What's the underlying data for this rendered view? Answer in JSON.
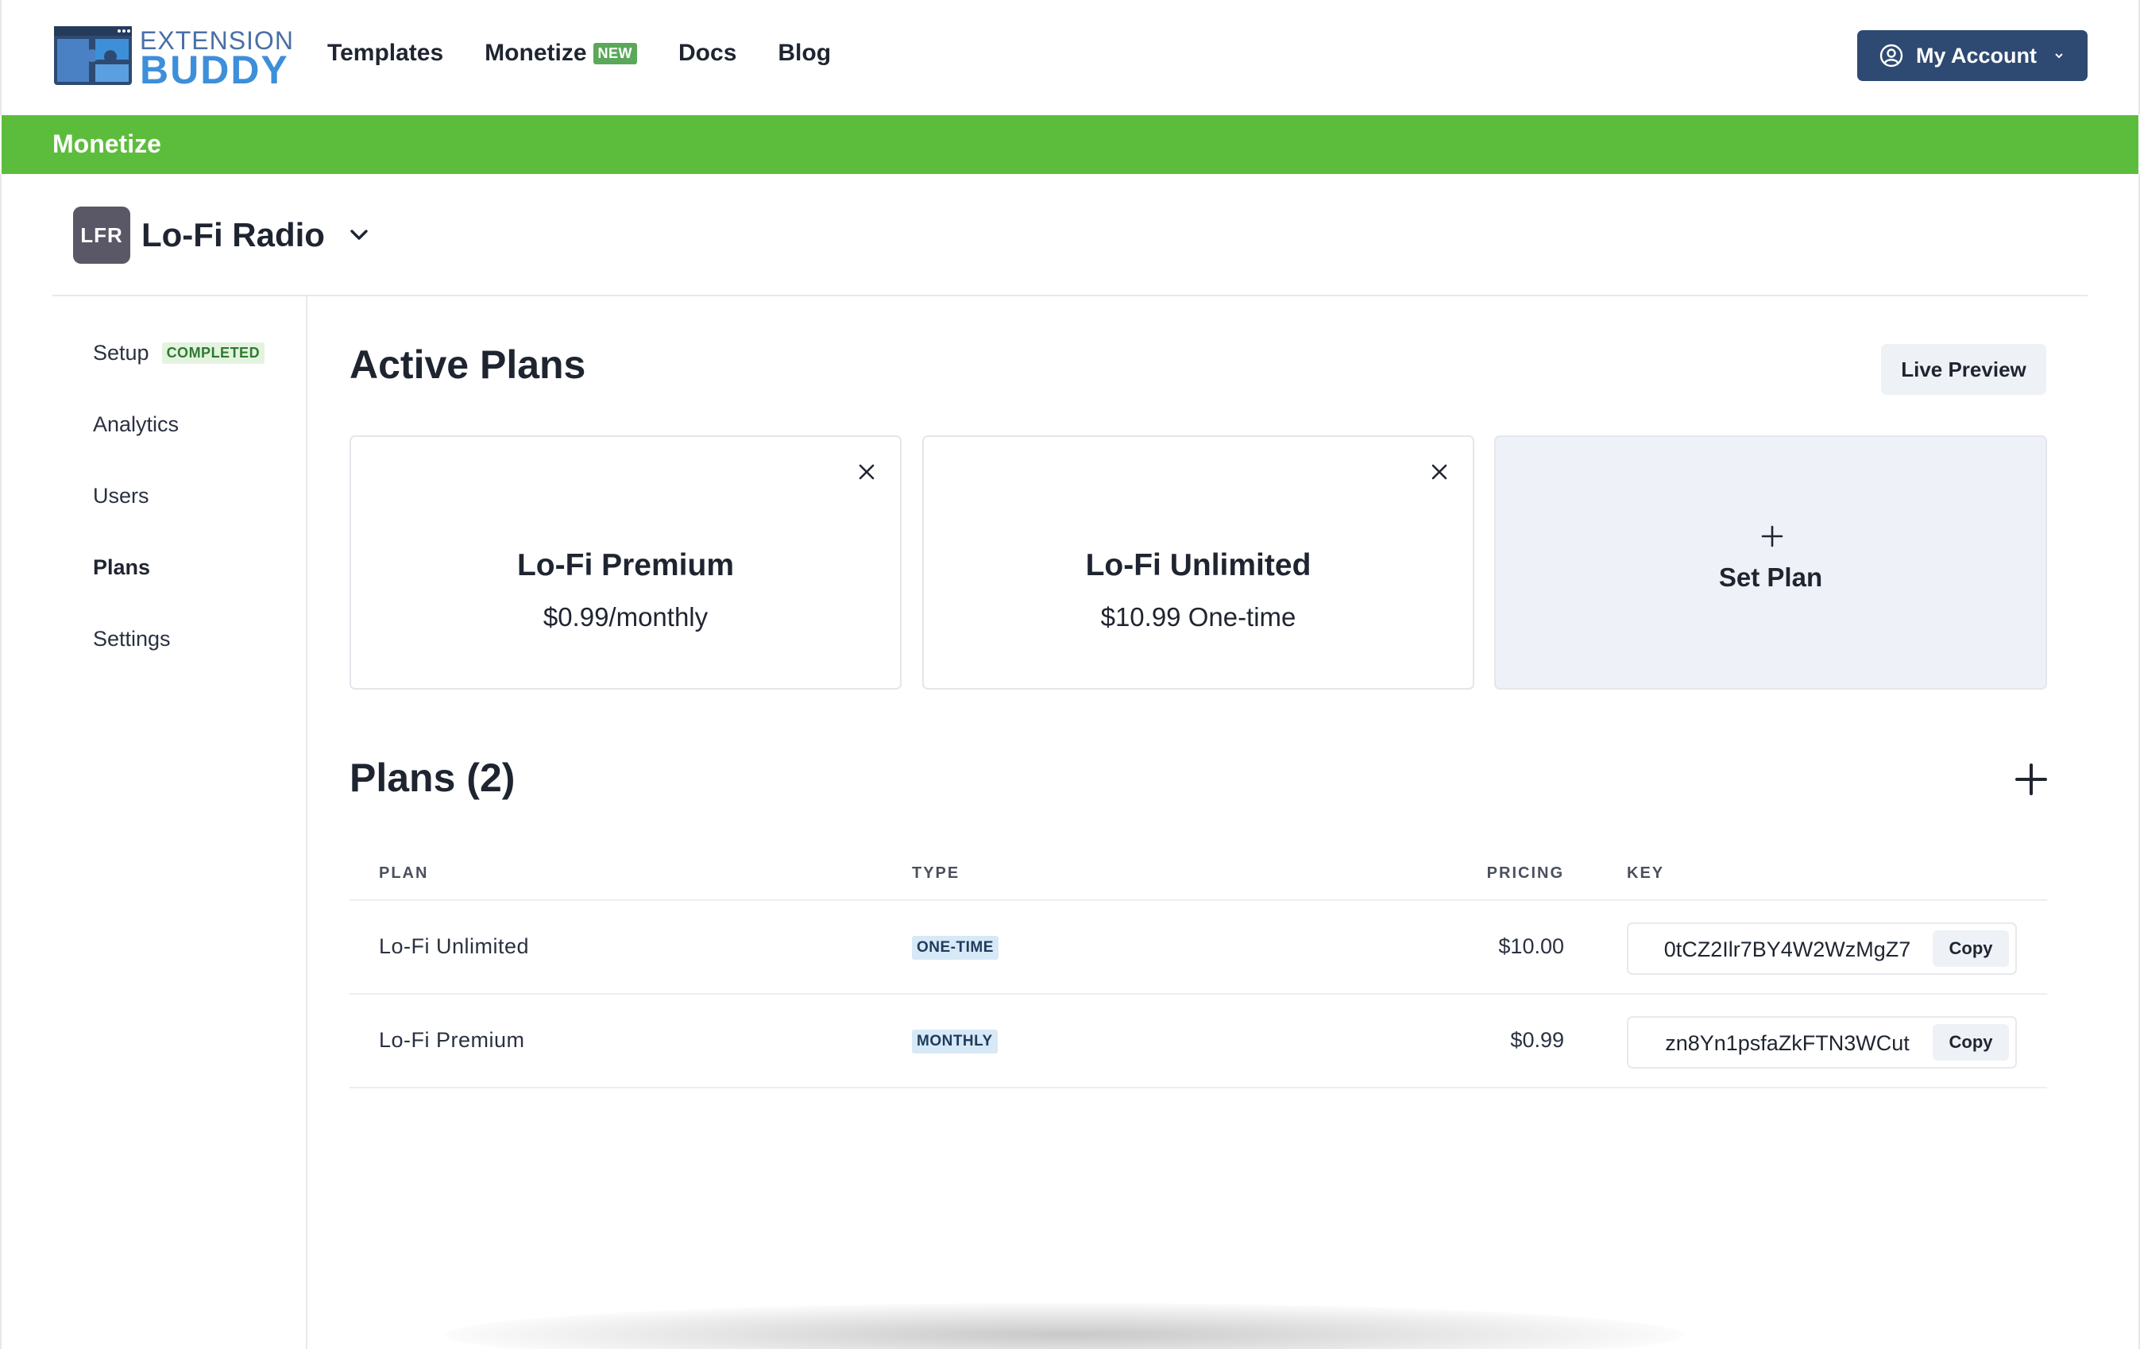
{
  "brand": {
    "line1": "EXTENSION",
    "line2": "BUDDY"
  },
  "nav": {
    "links": [
      {
        "label": "Templates"
      },
      {
        "label": "Monetize",
        "badge": "NEW"
      },
      {
        "label": "Docs"
      },
      {
        "label": "Blog"
      }
    ],
    "account_label": "My Account"
  },
  "section_title": "Monetize",
  "extension": {
    "initials": "LFR",
    "name": "Lo-Fi Radio"
  },
  "sidebar": {
    "items": [
      {
        "label": "Setup",
        "badge": "COMPLETED"
      },
      {
        "label": "Analytics"
      },
      {
        "label": "Users"
      },
      {
        "label": "Plans",
        "active": true
      },
      {
        "label": "Settings"
      }
    ]
  },
  "active_plans": {
    "title": "Active Plans",
    "live_preview_label": "Live Preview",
    "cards": [
      {
        "name": "Lo-Fi Premium",
        "price": "$0.99/monthly"
      },
      {
        "name": "Lo-Fi Unlimited",
        "price": "$10.99 One-time"
      }
    ],
    "set_plan_label": "Set Plan"
  },
  "plans_table": {
    "title": "Plans (2)",
    "columns": {
      "plan": "PLAN",
      "type": "TYPE",
      "pricing": "PRICING",
      "key": "KEY"
    },
    "rows": [
      {
        "plan": "Lo-Fi Unlimited",
        "type": "ONE-TIME",
        "pricing": "$10.00",
        "key": "0tCZ2Ilr7BY4W2WzMgZ7",
        "copy": "Copy"
      },
      {
        "plan": "Lo-Fi Premium",
        "type": "MONTHLY",
        "pricing": "$0.99",
        "key": "zn8Yn1psfaZkFTN3WCut",
        "copy": "Copy"
      }
    ]
  },
  "colors": {
    "accent_green": "#5cbd3c",
    "account_button": "#2e4a72",
    "brand_blue": "#3d8fd9"
  }
}
